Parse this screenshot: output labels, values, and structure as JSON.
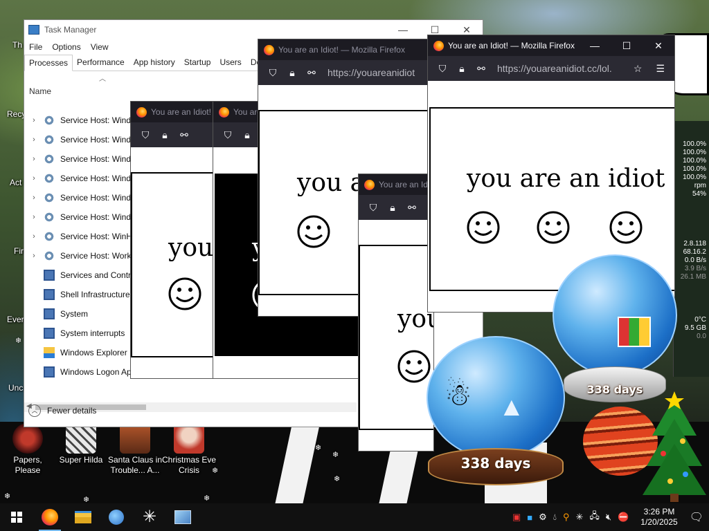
{
  "desktop": {
    "icons": [
      {
        "label": "Papers, Please"
      },
      {
        "label": "Super Hilda"
      },
      {
        "label": "Santa Claus in Trouble... A..."
      },
      {
        "label": "Christmas Eve Crisis"
      }
    ],
    "edge_labels": [
      "Th",
      "Recy",
      "Act",
      "Fir",
      "Ever",
      "Unc"
    ]
  },
  "task_manager": {
    "title": "Task Manager",
    "menu": [
      "File",
      "Options",
      "View"
    ],
    "tabs": [
      "Processes",
      "Performance",
      "App history",
      "Startup",
      "Users",
      "Deta"
    ],
    "active_tab": "Processes",
    "column_name": "Name",
    "rows": [
      {
        "name": "Service Host: Windo",
        "icon": "gear-icon",
        "expandable": true
      },
      {
        "name": "Service Host: Windo",
        "icon": "gear-icon",
        "expandable": true
      },
      {
        "name": "Service Host: Windo",
        "icon": "gear-icon",
        "expandable": true
      },
      {
        "name": "Service Host: Windo",
        "icon": "gear-icon",
        "expandable": true
      },
      {
        "name": "Service Host: Windo",
        "icon": "gear-icon",
        "expandable": true
      },
      {
        "name": "Service Host: Windo",
        "icon": "gear-icon",
        "expandable": true
      },
      {
        "name": "Service Host: WinHT",
        "icon": "gear-icon",
        "expandable": true
      },
      {
        "name": "Service Host: Works",
        "icon": "gear-icon",
        "expandable": true
      },
      {
        "name": "Services and Contro",
        "icon": "service-icon",
        "expandable": false
      },
      {
        "name": "Shell Infrastructure",
        "icon": "service-icon",
        "expandable": false
      },
      {
        "name": "System",
        "icon": "service-icon",
        "expandable": false
      },
      {
        "name": "System interrupts",
        "icon": "service-icon",
        "expandable": false
      },
      {
        "name": "Windows Explorer",
        "icon": "explorer-icon",
        "expandable": false
      },
      {
        "name": "Windows Logon Ap",
        "icon": "service-icon",
        "expandable": false
      }
    ],
    "fewer_details": "Fewer details"
  },
  "firefox_windows": [
    {
      "title": "You are an Idiot! —",
      "url": "",
      "page_text": "you",
      "page_text_2": ""
    },
    {
      "title": "You are",
      "url": "",
      "page_text": "y",
      "page_text_2": ""
    },
    {
      "title": "You are an Idiot! — Mozilla Firefox",
      "url": "https://youareanidiot",
      "page_text": "you a",
      "page_text_2": ""
    },
    {
      "title": "You are an Idiot",
      "url": "",
      "page_text": "you are an idio",
      "page_text_2": ""
    },
    {
      "title": "You are an Idiot! — Mozilla Firefox",
      "url": "https://youareanidiot.cc/lol.",
      "page_text": "you are an idiot",
      "page_text_2": ""
    }
  ],
  "system_monitor": [
    "100.0%",
    "100.0%",
    "100.0%",
    "100.0%",
    "100.0%",
    "rpm",
    "54%",
    "2.8.118",
    "68.16.2",
    "0.0 B/s",
    "3.9 B/s",
    "26.1 MB",
    "0°C",
    "9.5 GB",
    "0.0"
  ],
  "snow_globes": [
    {
      "days": "338 days"
    },
    {
      "days": "338 days"
    }
  ],
  "taskbar": {
    "pinned": [
      "firefox-icon",
      "file-explorer-icon",
      "app-icon",
      "snowflake-icon",
      "control-panel-icon"
    ],
    "time": "3:26 PM",
    "date": "1/20/2025"
  }
}
